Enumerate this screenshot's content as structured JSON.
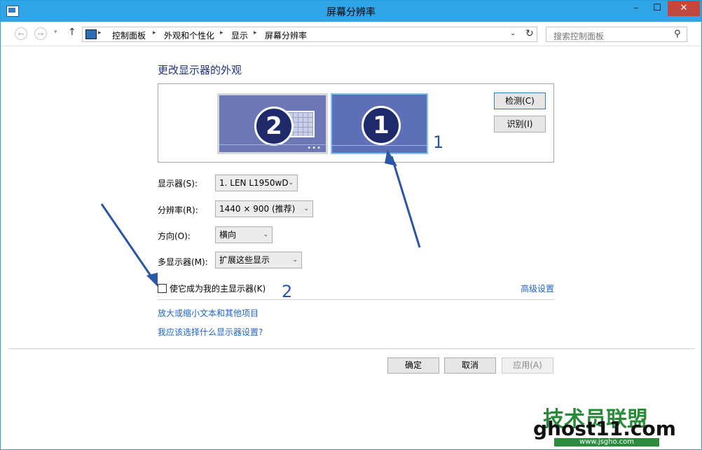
{
  "window": {
    "title": "屏幕分辨率"
  },
  "titlebar": {
    "min": "–",
    "max": "☐",
    "close": "✕"
  },
  "nav": {
    "back": "←",
    "forward": "→",
    "recent": "▾",
    "up": "↑"
  },
  "breadcrumb": [
    "控制面板",
    "外观和个性化",
    "显示",
    "屏幕分辨率"
  ],
  "breadcrumb_sep": "▸",
  "addressbar": {
    "dropdown": "⌄",
    "refresh": "↻"
  },
  "search": {
    "placeholder": "搜索控制面板",
    "icon": "⚲"
  },
  "heading": "更改显示器的外观",
  "monitors": [
    {
      "number": "2",
      "dots": "•••"
    },
    {
      "number": "1"
    }
  ],
  "preview_buttons": {
    "detect": "检测(C)",
    "identify": "识别(I)"
  },
  "form": {
    "display_label": "显示器(S):",
    "display_value": "1. LEN L1950wD",
    "resolution_label": "分辨率(R):",
    "resolution_value": "1440 × 900 (推荐)",
    "orientation_label": "方向(O):",
    "orientation_value": "横向",
    "multi_label": "多显示器(M):",
    "multi_value": "扩展这些显示",
    "arrow": "⌄"
  },
  "primary_checkbox": {
    "label": "使它成为我的主显示器(K)",
    "checked": false
  },
  "advanced_link": "高级设置",
  "links": [
    "放大或缩小文本和其他项目",
    "我应该选择什么显示器设置?"
  ],
  "buttons": {
    "ok": "确定",
    "cancel": "取消",
    "apply": "应用(A)"
  },
  "annotations": {
    "one": "1",
    "two": "2"
  },
  "watermark": {
    "title": "技术员联盟",
    "url": "ghost11.com",
    "sub": "www.jsgho.com"
  },
  "colors": {
    "titlebar": "#2fa4e6",
    "heading": "#1e3287",
    "link": "#1e64c8",
    "annotation": "#2a56a8"
  }
}
